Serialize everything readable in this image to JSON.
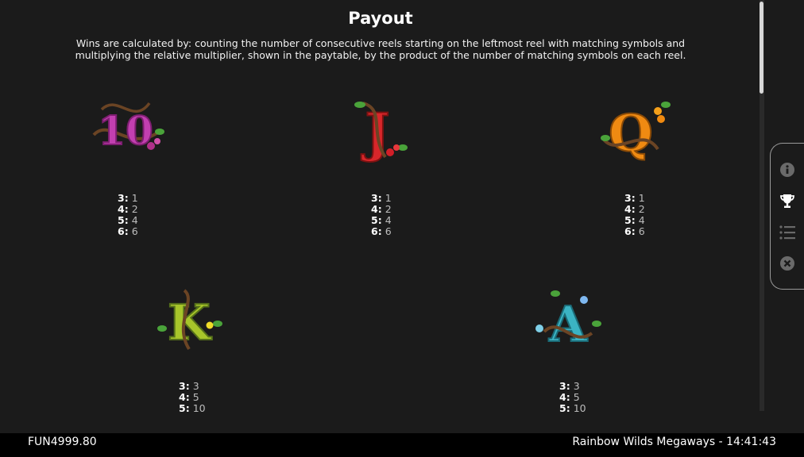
{
  "payout": {
    "title": "Payout",
    "description": "Wins are calculated by: counting the number of consecutive reels starting on the leftmost reel with matching symbols and multiplying the relative multiplier, shown in the paytable, by the product of the number of matching symbols on each reel."
  },
  "symbols": [
    {
      "letter": "10",
      "color": "#c23fb0",
      "pays": [
        {
          "count": "3:",
          "value": "1"
        },
        {
          "count": "4:",
          "value": "2"
        },
        {
          "count": "5:",
          "value": "4"
        },
        {
          "count": "6:",
          "value": "6"
        }
      ]
    },
    {
      "letter": "J",
      "color": "#d8262a",
      "pays": [
        {
          "count": "3:",
          "value": "1"
        },
        {
          "count": "4:",
          "value": "2"
        },
        {
          "count": "5:",
          "value": "4"
        },
        {
          "count": "6:",
          "value": "6"
        }
      ]
    },
    {
      "letter": "Q",
      "color": "#ef8a12",
      "pays": [
        {
          "count": "3:",
          "value": "1"
        },
        {
          "count": "4:",
          "value": "2"
        },
        {
          "count": "5:",
          "value": "4"
        },
        {
          "count": "6:",
          "value": "6"
        }
      ]
    },
    {
      "letter": "K",
      "color": "#a7c52a",
      "pays": [
        {
          "count": "3:",
          "value": "3"
        },
        {
          "count": "4:",
          "value": "5"
        },
        {
          "count": "5:",
          "value": "10"
        }
      ]
    },
    {
      "letter": "A",
      "color": "#3bb3c3",
      "pays": [
        {
          "count": "3:",
          "value": "3"
        },
        {
          "count": "4:",
          "value": "5"
        },
        {
          "count": "5:",
          "value": "10"
        }
      ]
    }
  ],
  "menu": {
    "icons": [
      "info-icon",
      "trophy-icon",
      "list-icon",
      "close-icon"
    ],
    "active": "trophy-icon"
  },
  "footer": {
    "balance": "FUN4999.80",
    "game_info": "Rainbow Wilds Megaways - 14:41:43"
  }
}
